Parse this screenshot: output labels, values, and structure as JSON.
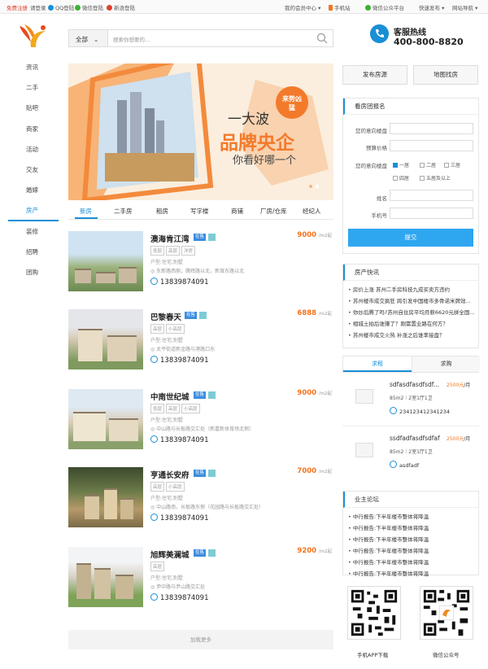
{
  "topbar": {
    "register": "免费注册",
    "login": "请登录",
    "qq_login": "QQ登陆",
    "wechat_login": "微信登陆",
    "weibo_login": "新浪登陆",
    "member_center": "我的会员中心",
    "mobile_site": "手机站",
    "wechat_public": "微信公众平台",
    "quick_post": "快速发布",
    "site_nav": "网站导航"
  },
  "search": {
    "category": "全部",
    "placeholder": "搜索你想要的..."
  },
  "hotline": {
    "title": "客服热线",
    "number": "400-800-8820"
  },
  "sidenav": [
    "资讯",
    "二手",
    "贴吧",
    "商家",
    "活动",
    "交友",
    "婚嫁",
    "房产",
    "装修",
    "招聘",
    "团购"
  ],
  "sidenav_active": "房产",
  "banner": {
    "line1": "一大波",
    "line2": "品牌央企",
    "line3": "你看好哪一个",
    "stamp": "来势凶猛"
  },
  "tabs": [
    "新房",
    "二手房",
    "租房",
    "写字楼",
    "商铺",
    "厂房/仓库",
    "经纪人"
  ],
  "listings": [
    {
      "title": "澳海肯江湾",
      "badge": "在售",
      "tags": [
        "低层",
        "高层",
        "洋房"
      ],
      "type": "户型:住宅,别墅",
      "addr": "东新路西侧，腾辉路以北，新茸东路以北",
      "phone": "13839874091",
      "price": "9000",
      "unit": "/m2起"
    },
    {
      "title": "巴黎春天",
      "badge": "在售",
      "tags": [
        "高层",
        "小高层"
      ],
      "type": "户型:住宅,别墅",
      "addr": "太平街道新金路与港路口东",
      "phone": "13839874091",
      "price": "6888",
      "unit": "/m2起"
    },
    {
      "title": "中南世纪城",
      "badge": "在售",
      "tags": [
        "低层",
        "高层",
        "小高层"
      ],
      "type": "户型:住宅,别墅",
      "addr": "中山路与长板路交汇处（新嘉新体育场北侧）",
      "phone": "13839874091",
      "price": "9000",
      "unit": "/m2起"
    },
    {
      "title": "亨通长安府",
      "badge": "在售",
      "tags": [
        "高层",
        "小高层"
      ],
      "type": "户型:住宅,别墅",
      "addr": "中山路南，长板路东侧（花园路与长板路交汇处）",
      "phone": "13839874091",
      "price": "7000",
      "unit": "/m2起"
    },
    {
      "title": "旭辉美澜城",
      "badge": "在售",
      "tags": [
        "高层"
      ],
      "type": "户型:住宅,别墅",
      "addr": "尹中路与尹山路交汇处",
      "phone": "13839874091",
      "price": "9200",
      "unit": "/m2起"
    }
  ],
  "load_more": "加载更多",
  "right_buttons": {
    "post": "发布房源",
    "map": "地图找房"
  },
  "signup": {
    "title": "看房团报名",
    "field_building": "您的意向楼盘",
    "field_budget": "预算价格",
    "field_type": "您的意向楼盘",
    "options": [
      "一居",
      "二居",
      "三居",
      "四居",
      "五居及以上"
    ],
    "field_name": "姓名",
    "field_phone": "手机号",
    "submit": "提交"
  },
  "news": {
    "title": "房产快讯",
    "items": [
      "房价上涨 苏州二手房科技九成买卖方违约",
      "苏州楼市成交疯狂 跨引发中国楼市多骨诺米牌效...",
      "你炒后腾了吗?苏州自住房平均月薪6620元拼全国...",
      "相城土拍后谁赚了？刚需置业路在何方？",
      "苏州楼市成交火热 补涨之后谁率接盘？"
    ]
  },
  "rent_tabs": [
    "求租",
    "求购"
  ],
  "rent_items": [
    {
      "title": "sdfasdfasdfsdf...",
      "price": "2500元",
      "unit": "/月",
      "detail": "85m2｜2室1厅1卫",
      "user": "234123412341234"
    },
    {
      "title": "ssdfadfasdfsdfaf",
      "price": "2500元",
      "unit": "/月",
      "detail": "85m2｜2室1厅1卫",
      "user": "asdfadf"
    }
  ],
  "forum": {
    "title": "业主论坛",
    "items": [
      "中行报告:下半年楼市整体将降温",
      "中行报告:下半年楼市整体将降温",
      "中行报告:下半年楼市整体将降温",
      "中行报告:下半年楼市整体将降温",
      "中行报告:下半年楼市整体将降温",
      "中行报告:下半年楼市整体将降温"
    ]
  },
  "qr": {
    "app": "手机APP下载",
    "wechat": "微信公众号"
  }
}
